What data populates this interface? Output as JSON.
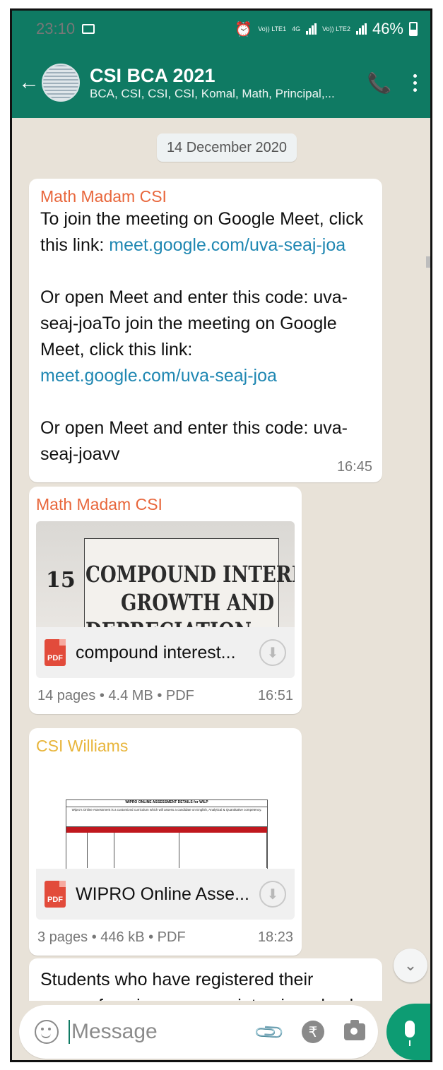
{
  "status_bar": {
    "time": "23:10",
    "network_1": "Vo)) LTE1",
    "network_2": "4G",
    "network_3": "Vo)) LTE2",
    "battery": "46%"
  },
  "header": {
    "back_icon": "arrow-left-icon",
    "title": "CSI BCA 2021",
    "subtitle": "BCA, CSI, CSI, CSI, Komal, Math, Principal,..."
  },
  "chat": {
    "date_pill": "14 December 2020",
    "messages": [
      {
        "sender": "Math Madam CSI",
        "sender_color": "#e8663b",
        "text_1": "To join the meeting on Google Meet, click this link: ",
        "link_1": "meet.google.com/uva-seaj-joa",
        "text_2": "\n\nOr open Meet and enter this code: uva-seaj-joaTo join the meeting on Google Meet, click this link: ",
        "link_2": "meet.google.com/uva-seaj-joa",
        "text_3": "\n\nOr open Meet and enter this code: uva-seaj-joavv",
        "time": "16:45"
      },
      {
        "sender": "Math Madam CSI",
        "sender_color": "#e8663b",
        "preview_num": "15",
        "preview_line_1": "COMPOUND INTEREST,",
        "preview_line_2": "GROWTH AND",
        "preview_line_3": "DEPRECIATION",
        "file_icon": "PDF",
        "file_name": "compound interest...",
        "meta": "14 pages • 4.4 MB • PDF",
        "time": "16:51"
      },
      {
        "sender": "CSI Williams",
        "sender_color": "#e8b53b",
        "preview_header": "WIPRO ONLINE ASSESSMENT DETAILS for WILP",
        "preview_text": "Wipro's Online Assessment is a customized curriculum which will assess a candidate on English, Analytical & Quantitative competency.",
        "file_icon": "PDF",
        "file_name": "WIPRO Online Asse...",
        "meta": "3 pages • 446 kB • PDF",
        "time": "18:23"
      },
      {
        "text": "Students who have registered their names for wipro campus interview check"
      }
    ]
  },
  "composer": {
    "placeholder": "Message",
    "rupee": "₹"
  },
  "colors": {
    "header_bg": "#0f7a63",
    "link": "#1f87b2",
    "mic_bg": "#0d9c73"
  }
}
